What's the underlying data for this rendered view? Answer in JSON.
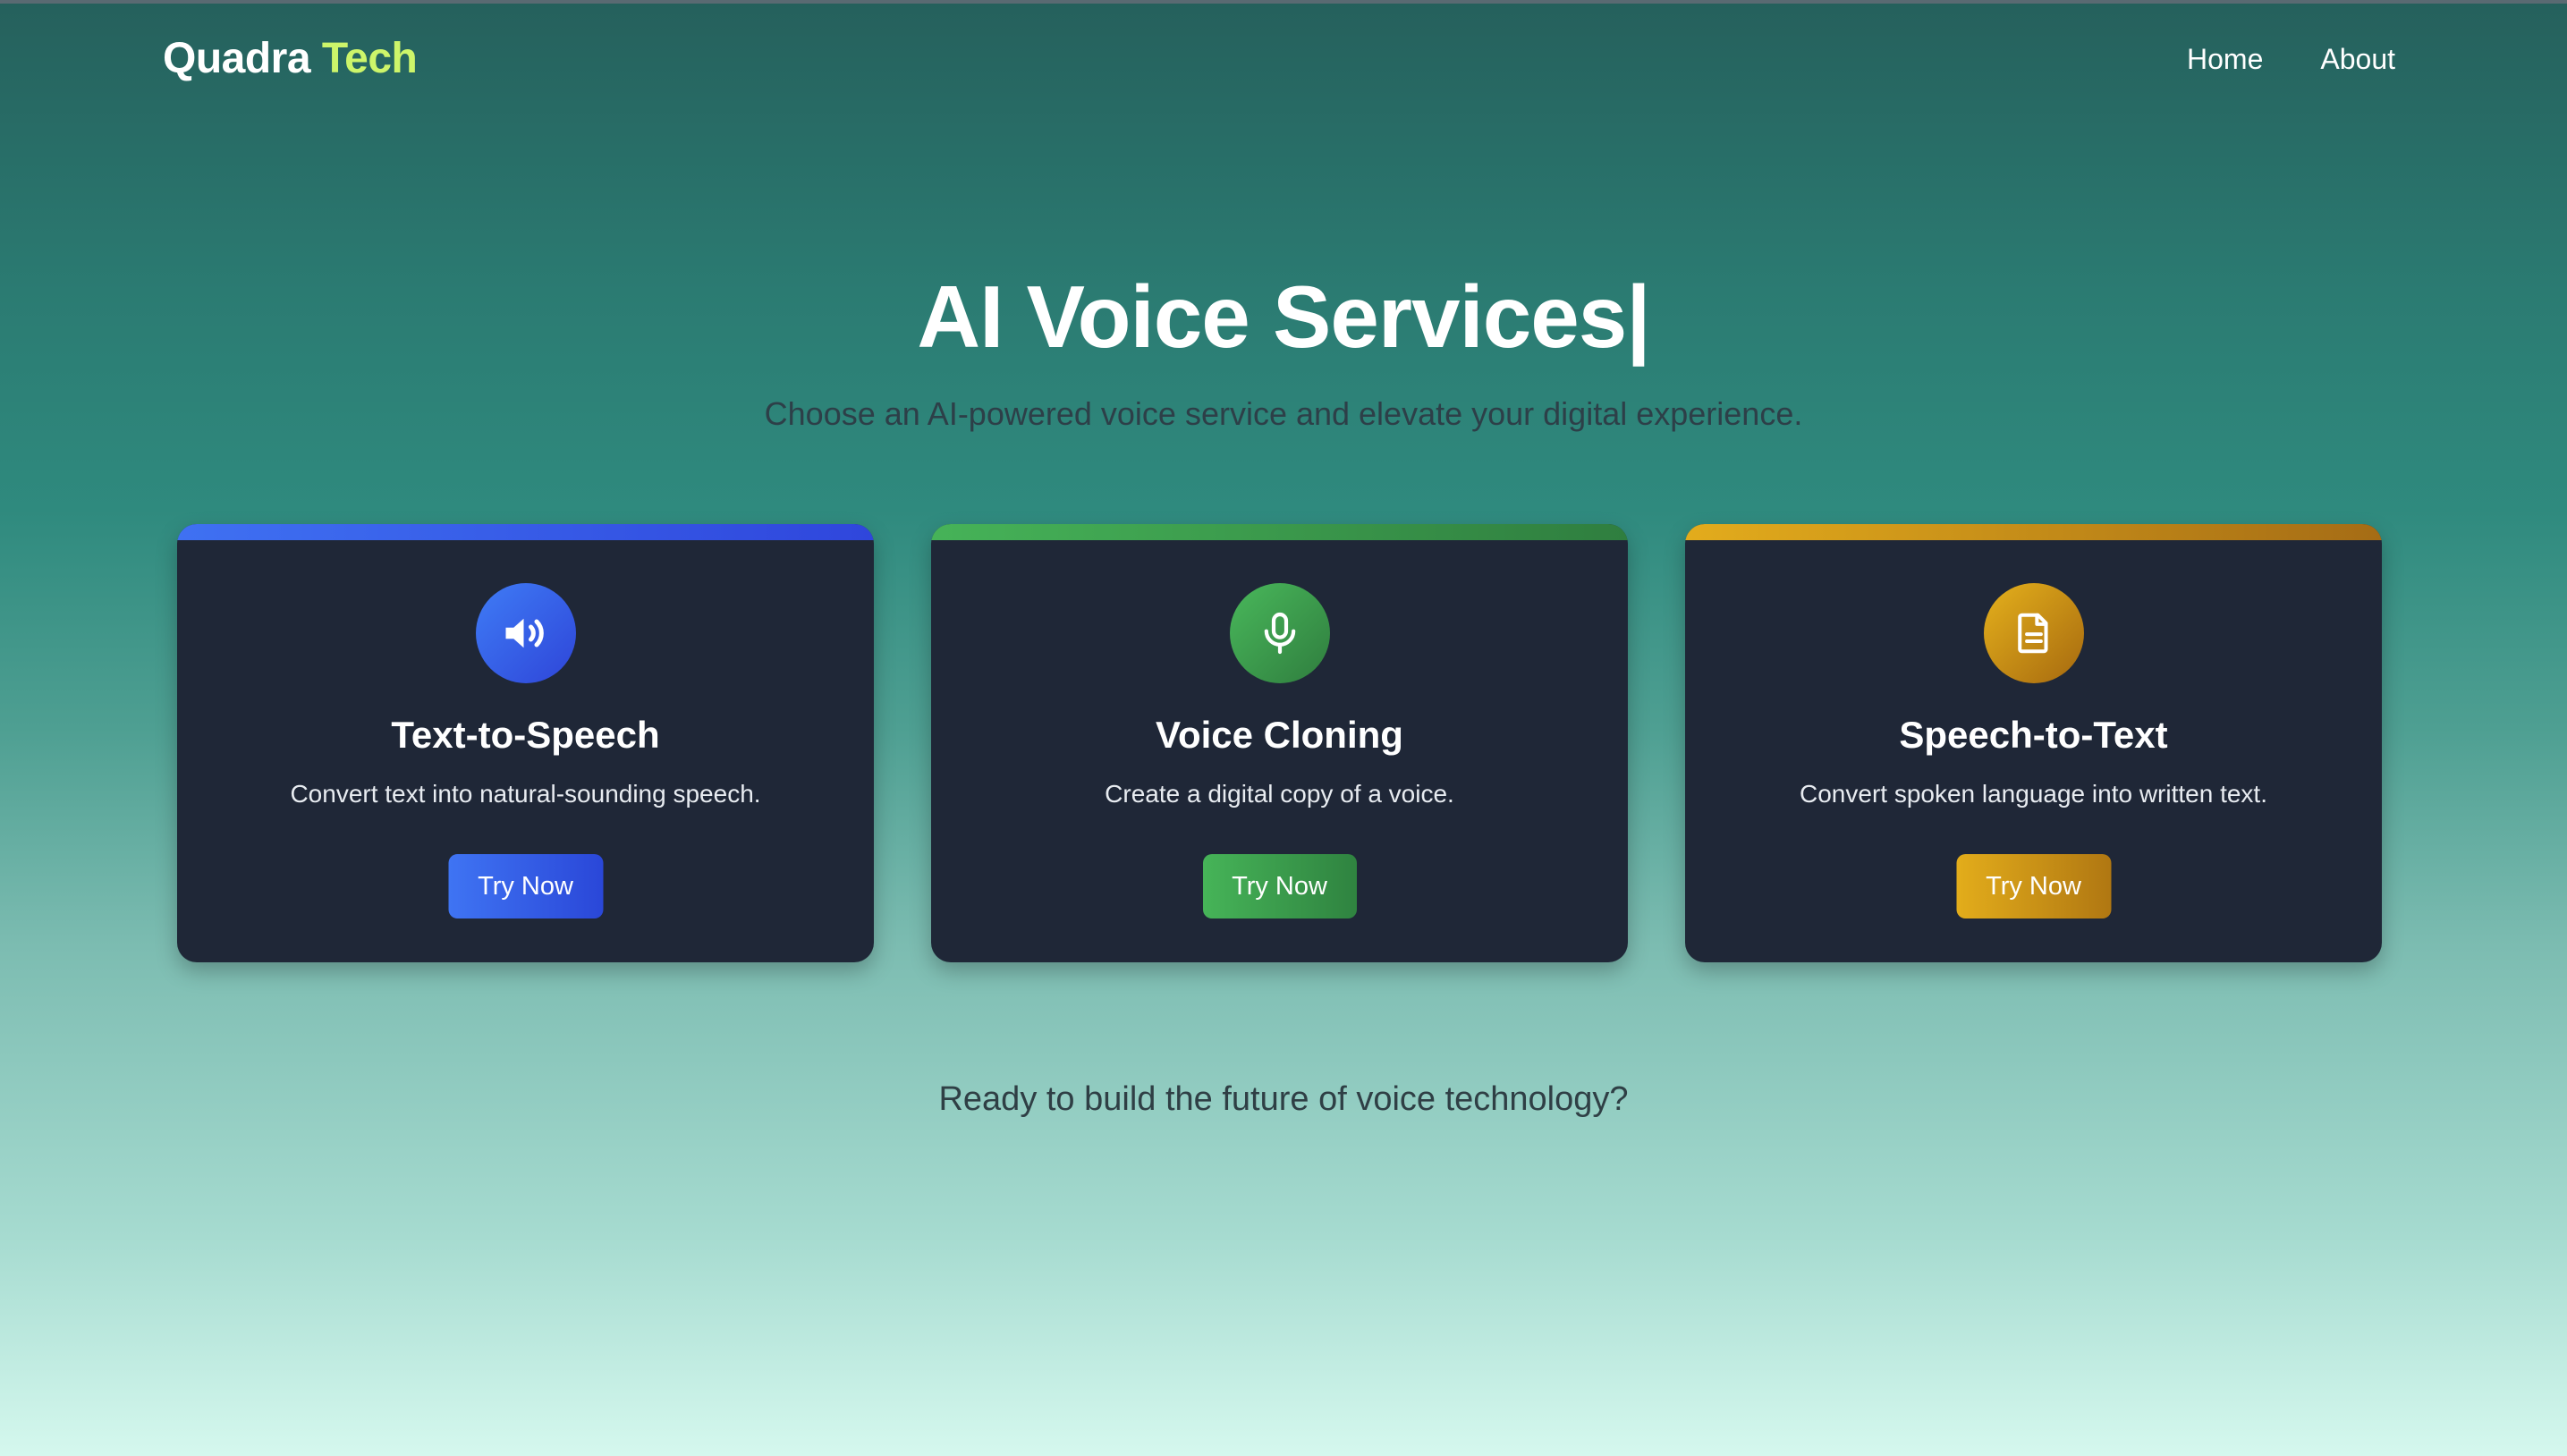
{
  "brand": {
    "name_part1": "Quadra",
    "name_part2": "Tech"
  },
  "nav": {
    "items": [
      "Home",
      "About"
    ]
  },
  "hero": {
    "title": "AI Voice Services|",
    "subtitle": "Choose an AI-powered voice service and elevate your digital experience."
  },
  "cards": [
    {
      "icon": "speaker-icon",
      "title": "Text-to-Speech",
      "description": "Convert text into natural-sounding speech.",
      "button": "Try Now",
      "accent": "#3b6ef0"
    },
    {
      "icon": "microphone-icon",
      "title": "Voice Cloning",
      "description": "Create a digital copy of a voice.",
      "button": "Try Now",
      "accent": "#45b157"
    },
    {
      "icon": "document-icon",
      "title": "Speech-to-Text",
      "description": "Convert spoken language into written text.",
      "button": "Try Now",
      "accent": "#e0a91b"
    }
  ],
  "cta": "Ready to build the future of voice technology?",
  "colors": {
    "card_bg": "#1f2737",
    "logo_accent": "#cdf56a"
  }
}
